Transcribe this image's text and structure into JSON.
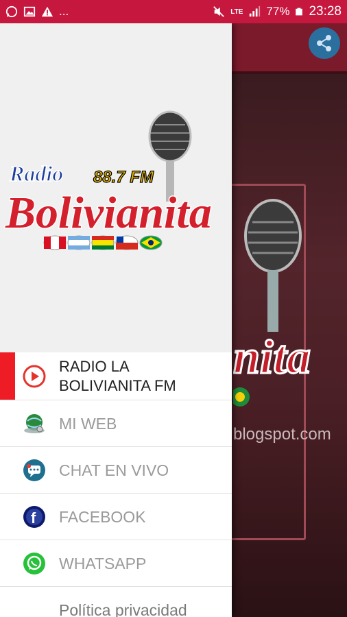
{
  "status_bar": {
    "battery_percent": "77%",
    "time": "23:28",
    "network": "LTE",
    "ellipsis": "...",
    "left_icons": [
      "whatsapp-icon",
      "image-icon",
      "warning-icon"
    ],
    "right_icons": [
      "mute-icon",
      "lte-icon",
      "signal-icon",
      "battery-icon"
    ]
  },
  "background": {
    "url_text": "blogspot.com",
    "logo_text_fragment": "nita"
  },
  "drawer": {
    "logo": {
      "radio": "Radio",
      "name": "Bolivianita",
      "frequency": "88.7 FM"
    },
    "menu": [
      {
        "label_line1": "RADIO LA",
        "label_line2": "BOLIVIANITA FM",
        "icon": "play-icon",
        "active": true
      },
      {
        "label": "MI WEB",
        "icon": "globe-icon"
      },
      {
        "label": "CHAT EN VIVO",
        "icon": "chat-icon"
      },
      {
        "label": "FACEBOOK",
        "icon": "facebook-icon"
      },
      {
        "label": "WHATSAPP",
        "icon": "whatsapp-icon"
      },
      {
        "label": "Política privacidad",
        "icon": ""
      }
    ]
  },
  "colors": {
    "status_bar": "#c6173f",
    "active_indicator": "#ee1c25",
    "share_button": "#2a6f9e"
  }
}
